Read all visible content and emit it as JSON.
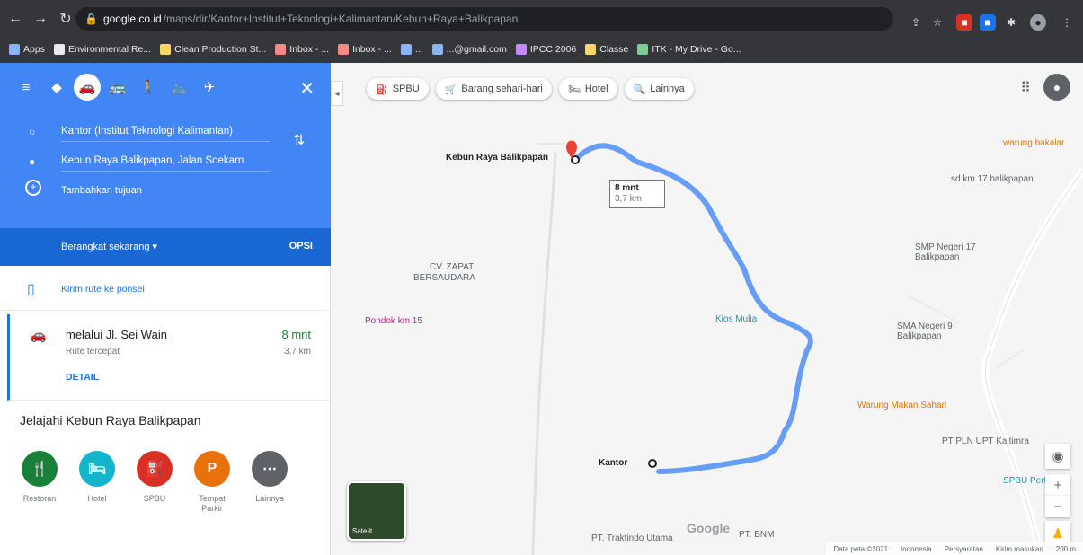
{
  "browser": {
    "url_host": "google.co.id",
    "url_path": "/maps/dir/Kantor+Institut+Teknologi+Kalimantan/Kebun+Raya+Balikpapan",
    "toolbar_icons": [
      "back-icon",
      "forward-icon",
      "reload-icon",
      "lock-icon",
      "star-icon",
      "profile-icon"
    ],
    "bookmarks": [
      {
        "label": "Apps",
        "color": "#8ab4f8"
      },
      {
        "label": "Environmental Re...",
        "color": "#e8eaed"
      },
      {
        "label": "Clean Production St...",
        "color": "#fdd663"
      },
      {
        "label": "Inbox - ...",
        "color": "#f28b82"
      },
      {
        "label": "Inbox - ...",
        "color": "#f28b82"
      },
      {
        "label": "...",
        "color": "#8ab4f8"
      },
      {
        "label": "...@gmail.com",
        "color": "#8ab4f8"
      },
      {
        "label": "IPCC 2006",
        "color": "#c58af9"
      },
      {
        "label": "Classe",
        "color": "#fdd663"
      },
      {
        "label": "ITK - My Drive - Go...",
        "color": "#81c995"
      }
    ]
  },
  "directions": {
    "modes": [
      "◆",
      "🚗",
      "🚌",
      "🚶",
      "🚲",
      "✈"
    ],
    "close": "✕",
    "origin": "Kantor (Institut Teknologi Kalimantan)",
    "destination": "Kebun Raya Balikpapan, Jalan Soekarn",
    "add_destination": "Tambahkan tujuan",
    "leave_now": "Berangkat sekarang  ▾",
    "options": "OPSI",
    "send_to_phone": "Kirim rute ke ponsel",
    "route": {
      "via": "melalui Jl. Sei Wain",
      "sub": "Rute tercepat",
      "time": "8 mnt",
      "distance": "3,7 km",
      "detail": "DETAIL"
    },
    "explore_title": "Jelajahi Kebun Raya Balikpapan",
    "categories": [
      {
        "label": "Restoran",
        "glyph": "🍴",
        "color": "#188038"
      },
      {
        "label": "Hotel",
        "glyph": "🛏",
        "color": "#12b5cb"
      },
      {
        "label": "SPBU",
        "glyph": "⛽",
        "color": "#d93025"
      },
      {
        "label": "Tempat Parkir",
        "glyph": "P",
        "color": "#e8710a"
      },
      {
        "label": "Lainnya",
        "glyph": "⋯",
        "color": "#5f6368"
      }
    ]
  },
  "map": {
    "chips": [
      {
        "label": "SPBU",
        "icon": "gas-icon"
      },
      {
        "label": "Barang sehari-hari",
        "icon": "cart-icon"
      },
      {
        "label": "Hotel",
        "icon": "bed-icon"
      },
      {
        "label": "Lainnya",
        "icon": "search-icon"
      }
    ],
    "eta": {
      "time": "8 mnt",
      "distance": "3,7 km"
    },
    "labels": {
      "kebun": "Kebun Raya Balikpapan",
      "kantor": "Kantor",
      "cv": "CV. ZAPAT",
      "cv2": "BERSAUDARA",
      "pondok": "Pondok km 15",
      "kios": "Kios Mulia",
      "warung_top": "warung bakalar",
      "sdn17": "SMP Negeri 17 Balikpapan",
      "sd_top": "sd km 17 balikpapan",
      "sdn": "SMA Negeri 9 Balikpapan",
      "warung": "Warung Makan Sahari",
      "pln": "PT PLN UPT Kaltimra",
      "spbu": "SPBU Pertamina",
      "pt1": "PT. Traktindo Utama",
      "pt2": "PT. BNM"
    },
    "satellite_label": "Satelit",
    "google_logo": "Google",
    "footer": [
      "Data peta ©2021",
      "Indonesia",
      "Persyaratan",
      "Kirim masukan",
      "200 m"
    ]
  }
}
